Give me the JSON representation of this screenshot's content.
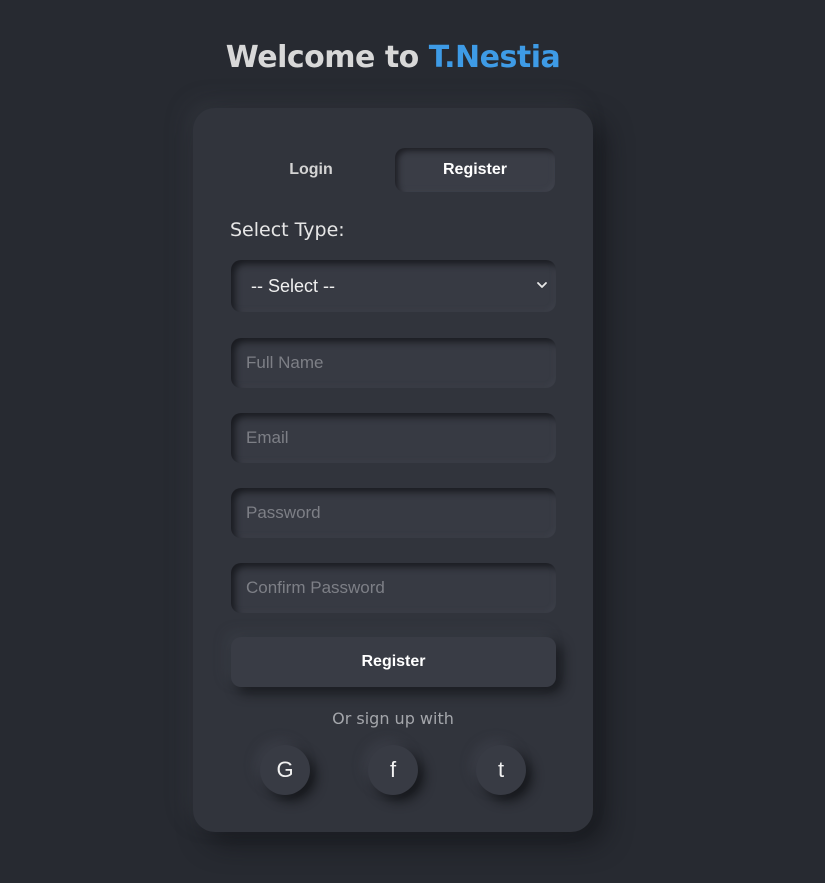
{
  "header": {
    "title_prefix": "Welcome to ",
    "title_brand": "T.Nestia"
  },
  "tabs": [
    {
      "label": "Login",
      "active": false
    },
    {
      "label": "Register",
      "active": true
    }
  ],
  "form": {
    "select_label": "Select Type:",
    "select_value": "-- Select --",
    "fields": [
      {
        "placeholder": "Full Name",
        "value": ""
      },
      {
        "placeholder": "Email",
        "value": ""
      },
      {
        "placeholder": "Password",
        "value": ""
      },
      {
        "placeholder": "Confirm Password",
        "value": ""
      }
    ],
    "submit_label": "Register"
  },
  "social": {
    "heading": "Or sign up with",
    "buttons": [
      {
        "icon": "google-icon",
        "glyph": "G"
      },
      {
        "icon": "facebook-icon",
        "glyph": "f"
      },
      {
        "icon": "twitter-icon",
        "glyph": "t"
      }
    ]
  },
  "colors": {
    "background": "#272a31",
    "card": "#31343c",
    "brand_accent": "#3e9be6"
  }
}
